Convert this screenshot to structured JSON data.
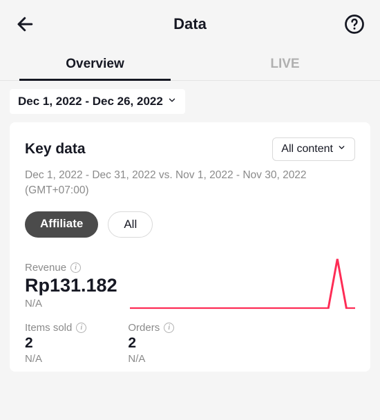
{
  "header": {
    "title": "Data"
  },
  "tabs": {
    "overview": "Overview",
    "live": "LIVE"
  },
  "date_range": "Dec 1, 2022 - Dec 26, 2022",
  "card": {
    "title": "Key data",
    "filter_label": "All content",
    "compare_text": "Dec 1, 2022 - Dec 31, 2022 vs. Nov 1, 2022 - Nov 30, 2022 (GMT+07:00)",
    "chips": {
      "affiliate": "Affiliate",
      "all": "All"
    },
    "revenue": {
      "label": "Revenue",
      "value": "Rp131.182",
      "sub": "N/A"
    },
    "items_sold": {
      "label": "Items sold",
      "value": "2",
      "sub": "N/A"
    },
    "orders": {
      "label": "Orders",
      "value": "2",
      "sub": "N/A"
    }
  },
  "chart_data": {
    "type": "line",
    "title": "Revenue sparkline",
    "xlabel": "",
    "ylabel": "",
    "x": [
      0,
      1,
      2,
      3,
      4,
      5,
      6,
      7,
      8,
      9,
      10,
      11,
      12,
      13,
      14,
      15,
      16,
      17,
      18,
      19,
      20,
      21,
      22,
      23,
      24,
      25
    ],
    "values": [
      0,
      0,
      0,
      0,
      0,
      0,
      0,
      0,
      0,
      0,
      0,
      0,
      0,
      0,
      0,
      0,
      0,
      0,
      0,
      0,
      0,
      0,
      0,
      131182,
      0,
      0
    ],
    "ylim": [
      0,
      140000
    ]
  }
}
